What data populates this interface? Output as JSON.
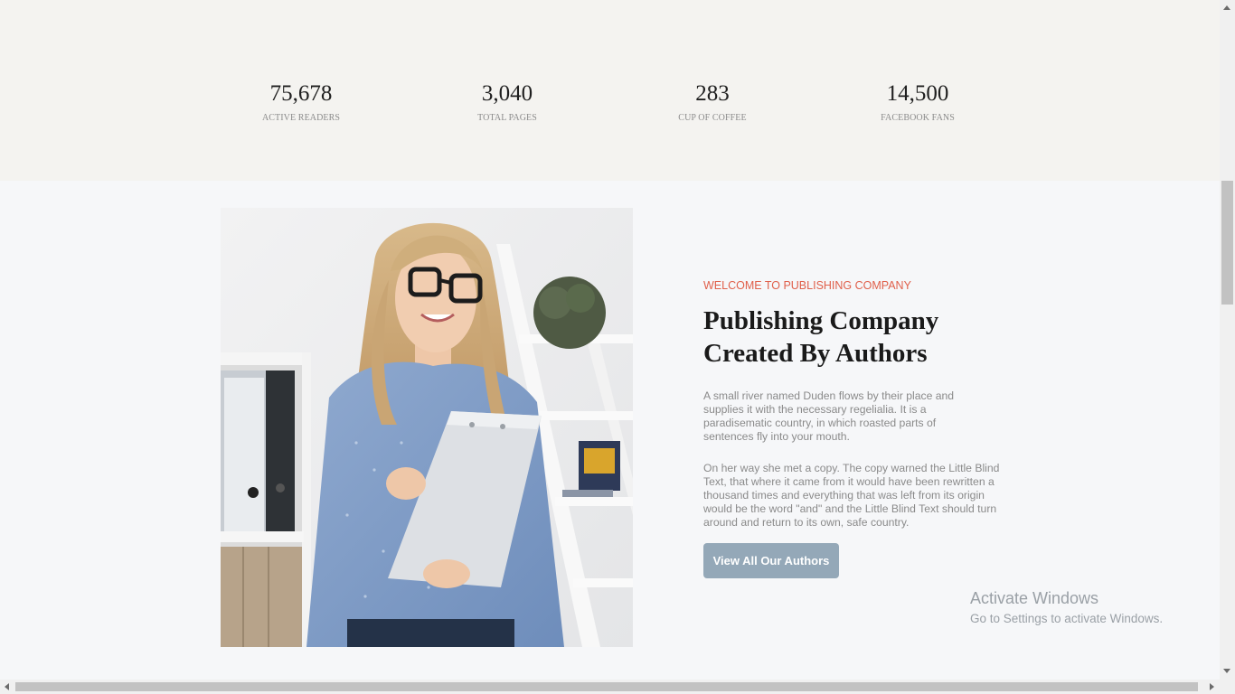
{
  "stats": [
    {
      "number": "75,678",
      "label": "ACTIVE READERS"
    },
    {
      "number": "3,040",
      "label": "TOTAL PAGES"
    },
    {
      "number": "283",
      "label": "CUP OF COFFEE"
    },
    {
      "number": "14,500",
      "label": "FACEBOOK FANS"
    }
  ],
  "about": {
    "eyebrow": "WELCOME TO PUBLISHING COMPANY",
    "heading": "Publishing Company Created By Authors",
    "paragraphs": [
      "A small river named Duden flows by their place and supplies it with the necessary regelialia. It is a paradisematic country, in which roasted parts of sentences fly into your mouth.",
      "On her way she met a copy. The copy warned the Little Blind Text, that where it came from it would have been rewritten a thousand times and everything that was left from its origin would be the word \"and\" and the Little Blind Text should turn around and return to its own, safe country."
    ],
    "button_label": "View All Our Authors"
  },
  "colors": {
    "accent": "#e0604b",
    "button": "#94a8b8",
    "stats_background": "#f4f3f0",
    "page_background": "#f6f7f9"
  },
  "watermark": {
    "title": "Activate Windows",
    "subtitle": "Go to Settings to activate Windows."
  },
  "icons": {
    "scroll_up": "triangle-up-icon",
    "scroll_down": "triangle-down-icon",
    "scroll_left": "triangle-left-icon",
    "scroll_right": "triangle-right-icon"
  }
}
